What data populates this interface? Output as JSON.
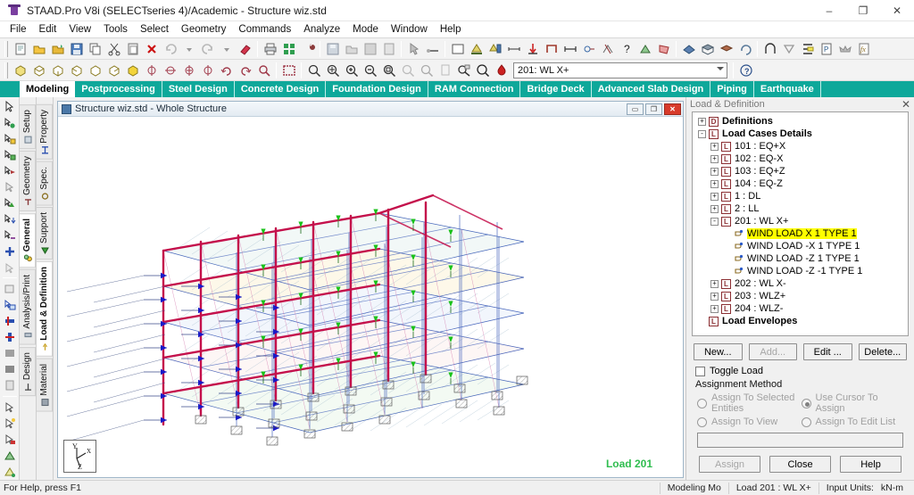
{
  "window": {
    "title": "STAAD.Pro V8i (SELECTseries 4)/Academic - Structure wiz.std",
    "app_icon": "staad-logo-icon",
    "minimize": "–",
    "maximize": "❐",
    "close": "✕"
  },
  "menu": {
    "items": [
      {
        "label": "File"
      },
      {
        "label": "Edit"
      },
      {
        "label": "View"
      },
      {
        "label": "Tools"
      },
      {
        "label": "Select"
      },
      {
        "label": "Geometry"
      },
      {
        "label": "Commands"
      },
      {
        "label": "Analyze"
      },
      {
        "label": "Mode"
      },
      {
        "label": "Window"
      },
      {
        "label": "Help"
      }
    ]
  },
  "toolbar_view": {
    "load_combo_value": "201: WL X+",
    "help_icon": "help-question-icon"
  },
  "mode_tabs": {
    "items": [
      {
        "label": "Modeling",
        "active": true
      },
      {
        "label": "Postprocessing",
        "active": false
      },
      {
        "label": "Steel Design",
        "active": false
      },
      {
        "label": "Concrete Design",
        "active": false
      },
      {
        "label": "Foundation Design",
        "active": false
      },
      {
        "label": "RAM Connection",
        "active": false
      },
      {
        "label": "Bridge Deck",
        "active": false
      },
      {
        "label": "Advanced Slab Design",
        "active": false
      },
      {
        "label": "Piping",
        "active": false
      },
      {
        "label": "Earthquake",
        "active": false
      }
    ]
  },
  "page_tabs_outer": {
    "items": [
      {
        "label": "Setup",
        "active": false
      },
      {
        "label": "Geometry",
        "active": false
      },
      {
        "label": "General",
        "active": true
      },
      {
        "label": "Analysis/Print",
        "active": false
      },
      {
        "label": "Design",
        "active": false
      }
    ]
  },
  "page_tabs_inner": {
    "items": [
      {
        "label": "Property",
        "active": false
      },
      {
        "label": "Spec.",
        "active": false
      },
      {
        "label": "Support",
        "active": false
      },
      {
        "label": "Load & Definition",
        "active": true
      },
      {
        "label": "Material",
        "active": false
      }
    ]
  },
  "child_window": {
    "title": "Structure wiz.std - Whole Structure",
    "restore_label": "▭",
    "maximize_label": "❐",
    "close_label": "✕",
    "load_overlay": "Load 201",
    "axis": {
      "y": "Y",
      "x": "X",
      "z": "Z"
    }
  },
  "load_panel": {
    "title": "Load & Definition",
    "close_icon": "close-icon",
    "tree": [
      {
        "level": 0,
        "expander": "+",
        "icon": "D",
        "icon_class": "def",
        "label": "Definitions",
        "bold": true,
        "highlight": false
      },
      {
        "level": 0,
        "expander": "-",
        "icon": "L",
        "icon_class": "lc",
        "label": "Load Cases Details",
        "bold": true,
        "highlight": false
      },
      {
        "level": 1,
        "expander": "+",
        "icon": "L",
        "icon_class": "lc",
        "label": "101 : EQ+X",
        "bold": false,
        "highlight": false
      },
      {
        "level": 1,
        "expander": "+",
        "icon": "L",
        "icon_class": "lc",
        "label": "102 : EQ-X",
        "bold": false,
        "highlight": false
      },
      {
        "level": 1,
        "expander": "+",
        "icon": "L",
        "icon_class": "lc",
        "label": "103 : EQ+Z",
        "bold": false,
        "highlight": false
      },
      {
        "level": 1,
        "expander": "+",
        "icon": "L",
        "icon_class": "lc",
        "label": "104 : EQ-Z",
        "bold": false,
        "highlight": false
      },
      {
        "level": 1,
        "expander": "+",
        "icon": "L",
        "icon_class": "lc",
        "label": "1 : DL",
        "bold": false,
        "highlight": false
      },
      {
        "level": 1,
        "expander": "+",
        "icon": "L",
        "icon_class": "lc",
        "label": "2 : LL",
        "bold": false,
        "highlight": false
      },
      {
        "level": 1,
        "expander": "-",
        "icon": "L",
        "icon_class": "lc",
        "label": "201 : WL X+",
        "bold": false,
        "highlight": false
      },
      {
        "level": 2,
        "expander": "",
        "icon": "wind",
        "icon_class": "wind",
        "label": "WIND LOAD X 1 TYPE 1",
        "bold": false,
        "highlight": true
      },
      {
        "level": 2,
        "expander": "",
        "icon": "wind",
        "icon_class": "wind",
        "label": "WIND LOAD -X 1 TYPE 1",
        "bold": false,
        "highlight": false
      },
      {
        "level": 2,
        "expander": "",
        "icon": "wind",
        "icon_class": "wind",
        "label": "WIND LOAD -Z 1 TYPE 1",
        "bold": false,
        "highlight": false
      },
      {
        "level": 2,
        "expander": "",
        "icon": "wind",
        "icon_class": "wind",
        "label": "WIND LOAD -Z -1 TYPE 1",
        "bold": false,
        "highlight": false
      },
      {
        "level": 1,
        "expander": "+",
        "icon": "L",
        "icon_class": "lc",
        "label": "202 : WL X-",
        "bold": false,
        "highlight": false
      },
      {
        "level": 1,
        "expander": "+",
        "icon": "L",
        "icon_class": "lc",
        "label": "203 : WLZ+",
        "bold": false,
        "highlight": false
      },
      {
        "level": 1,
        "expander": "+",
        "icon": "L",
        "icon_class": "lc",
        "label": "204 : WLZ-",
        "bold": false,
        "highlight": false
      },
      {
        "level": 0,
        "expander": "",
        "icon": "L",
        "icon_class": "lc",
        "label": "Load Envelopes",
        "bold": true,
        "highlight": false
      }
    ],
    "buttons": {
      "new": "New...",
      "add": "Add...",
      "edit": "Edit ...",
      "delete": "Delete..."
    },
    "toggle_load": "Toggle Load",
    "assignment_method_label": "Assignment Method",
    "radios": [
      {
        "label": "Assign To Selected Entities",
        "selected": false
      },
      {
        "label": "Use Cursor To Assign",
        "selected": true
      },
      {
        "label": "Assign To View",
        "selected": false
      },
      {
        "label": "Assign To Edit List",
        "selected": false
      }
    ],
    "edit_list_value": "",
    "bottom_buttons": {
      "assign": "Assign",
      "close": "Close",
      "help": "Help"
    }
  },
  "statusbar": {
    "hint": "For Help, press F1",
    "mode": "Modeling Mo",
    "load": "Load 201 : WL X+",
    "units_label": "Input Units:",
    "units_value": "kN-m"
  },
  "colors": {
    "tab_teal": "#0ea89a",
    "beam_crimson": "#c4104b",
    "wind_arrow_blue": "#1a1ac8",
    "green_arrow": "#19c219",
    "load_label_green": "#2fbd4f",
    "highlight_yellow": "#ffff00"
  }
}
